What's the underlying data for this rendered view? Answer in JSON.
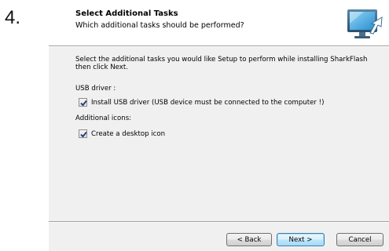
{
  "step_number": "4.",
  "header": {
    "title": "Select Additional Tasks",
    "subtitle": "Which additional tasks should be performed?"
  },
  "instruction": "Select the additional tasks you would like Setup to perform while installing SharkFlash then click Next.",
  "groups": [
    {
      "label": "USB driver :",
      "tasks": [
        {
          "label": "Install USB driver (USB device must be connected to the computer !)",
          "checked": true
        }
      ]
    },
    {
      "label": "Additional icons:",
      "tasks": [
        {
          "label": "Create a desktop icon",
          "checked": true
        }
      ]
    }
  ],
  "buttons": {
    "back": "< Back",
    "next": "Next >",
    "cancel": "Cancel"
  },
  "colors": {
    "body_bg": "#f0f0f0",
    "header_bg": "#ffffff",
    "default_button_border": "#3c7fb1"
  },
  "icons": {
    "header": "setup-monitor-icon"
  }
}
